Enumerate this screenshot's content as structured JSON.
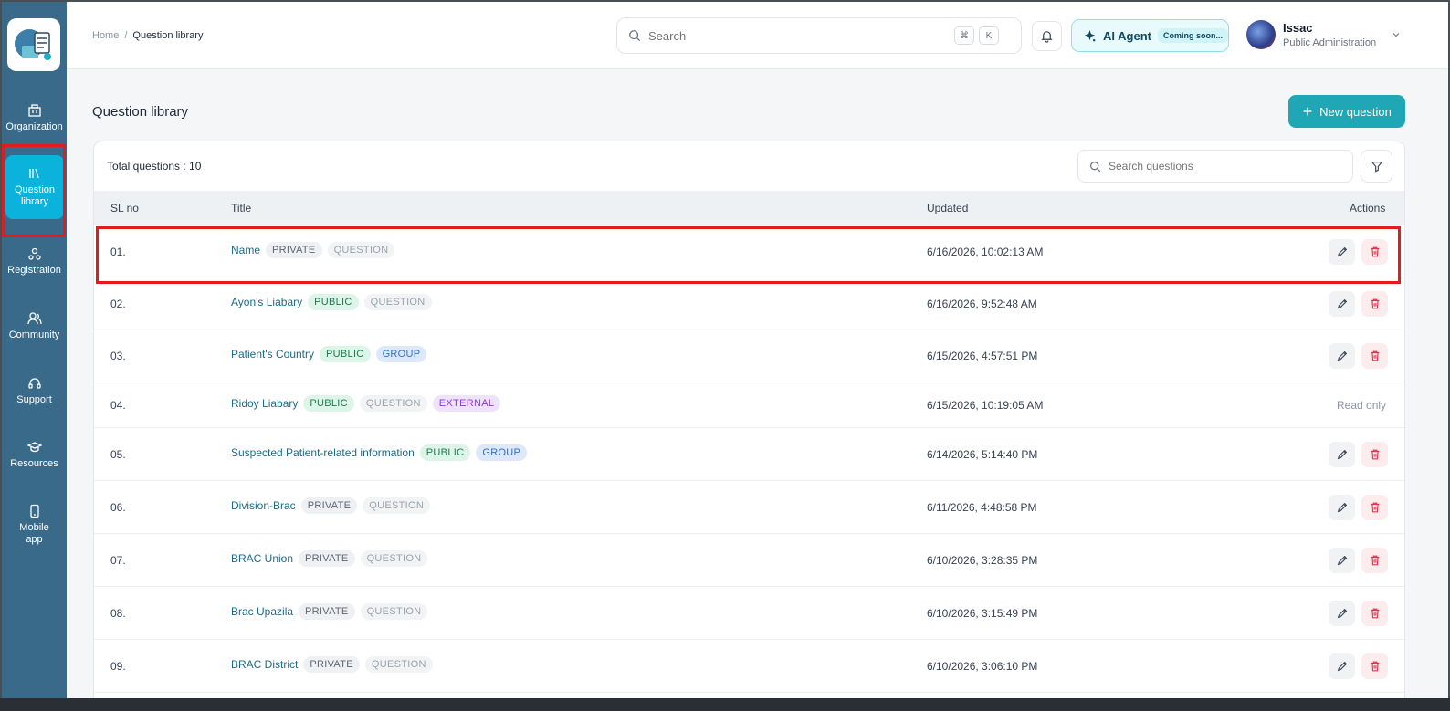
{
  "sidebar": {
    "items": [
      {
        "label": "Organization",
        "icon": "building-icon"
      },
      {
        "label": "Question library",
        "icon": "library-icon"
      },
      {
        "label": "Registration",
        "icon": "registration-icon"
      },
      {
        "label": "Community",
        "icon": "users-icon"
      },
      {
        "label": "Support",
        "icon": "headset-icon"
      },
      {
        "label": "Resources",
        "icon": "graduation-cap-icon"
      },
      {
        "label": "Mobile app",
        "icon": "mobile-icon"
      }
    ],
    "active_color": "#0bb3dc"
  },
  "header": {
    "breadcrumb_home": "Home",
    "breadcrumb_sep": "/",
    "breadcrumb_current": "Question library",
    "search_placeholder": "Search",
    "kbd_cmd": "⌘",
    "kbd_k": "K",
    "ai_label": "AI Agent",
    "ai_badge": "Coming soon...",
    "user_name": "Issac",
    "user_role": "Public Administration"
  },
  "main": {
    "title": "Question library",
    "new_button": "New question",
    "total_label": "Total questions : 10",
    "search_placeholder": "Search questions",
    "columns": {
      "sl": "SL no",
      "title": "Title",
      "updated": "Updated",
      "actions": "Actions"
    },
    "read_only_label": "Read only",
    "rows": [
      {
        "sl": "01.",
        "title": "Name",
        "tags": [
          "PRIVATE",
          "QUESTION"
        ],
        "updated": "6/16/2026, 10:02:13 AM",
        "editable": true
      },
      {
        "sl": "02.",
        "title": "Ayon's Liabary",
        "tags": [
          "PUBLIC",
          "QUESTION"
        ],
        "updated": "6/16/2026, 9:52:48 AM",
        "editable": true
      },
      {
        "sl": "03.",
        "title": "Patient's Country",
        "tags": [
          "PUBLIC",
          "GROUP"
        ],
        "updated": "6/15/2026, 4:57:51 PM",
        "editable": true
      },
      {
        "sl": "04.",
        "title": "Ridoy Liabary",
        "tags": [
          "PUBLIC",
          "QUESTION",
          "EXTERNAL"
        ],
        "updated": "6/15/2026, 10:19:05 AM",
        "editable": false
      },
      {
        "sl": "05.",
        "title": "Suspected Patient-related information",
        "tags": [
          "PUBLIC",
          "GROUP"
        ],
        "updated": "6/14/2026, 5:14:40 PM",
        "editable": true
      },
      {
        "sl": "06.",
        "title": "Division-Brac",
        "tags": [
          "PRIVATE",
          "QUESTION"
        ],
        "updated": "6/11/2026, 4:48:58 PM",
        "editable": true
      },
      {
        "sl": "07.",
        "title": "BRAC Union",
        "tags": [
          "PRIVATE",
          "QUESTION"
        ],
        "updated": "6/10/2026, 3:28:35 PM",
        "editable": true
      },
      {
        "sl": "08.",
        "title": "Brac Upazila",
        "tags": [
          "PRIVATE",
          "QUESTION"
        ],
        "updated": "6/10/2026, 3:15:49 PM",
        "editable": true
      },
      {
        "sl": "09.",
        "title": "BRAC District",
        "tags": [
          "PRIVATE",
          "QUESTION"
        ],
        "updated": "6/10/2026, 3:06:10 PM",
        "editable": true
      }
    ]
  },
  "colors": {
    "sidebar_bg": "#3a6a8a",
    "primary_button": "#1fa7b5",
    "highlight": "#e31b1b"
  }
}
